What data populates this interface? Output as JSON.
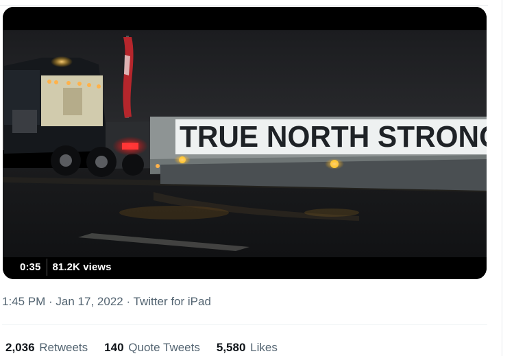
{
  "video": {
    "banner_text": "TRUE NORTH STRONG",
    "duration": "0:35",
    "views": "81.2K views"
  },
  "tweet_meta": {
    "time": "1:45 PM",
    "separator": " · ",
    "date": "Jan 17, 2022",
    "source": "Twitter for iPad"
  },
  "stats": {
    "retweets_count": "2,036",
    "retweets_label": "Retweets",
    "quotes_count": "140",
    "quotes_label": "Quote Tweets",
    "likes_count": "5,580",
    "likes_label": "Likes"
  }
}
